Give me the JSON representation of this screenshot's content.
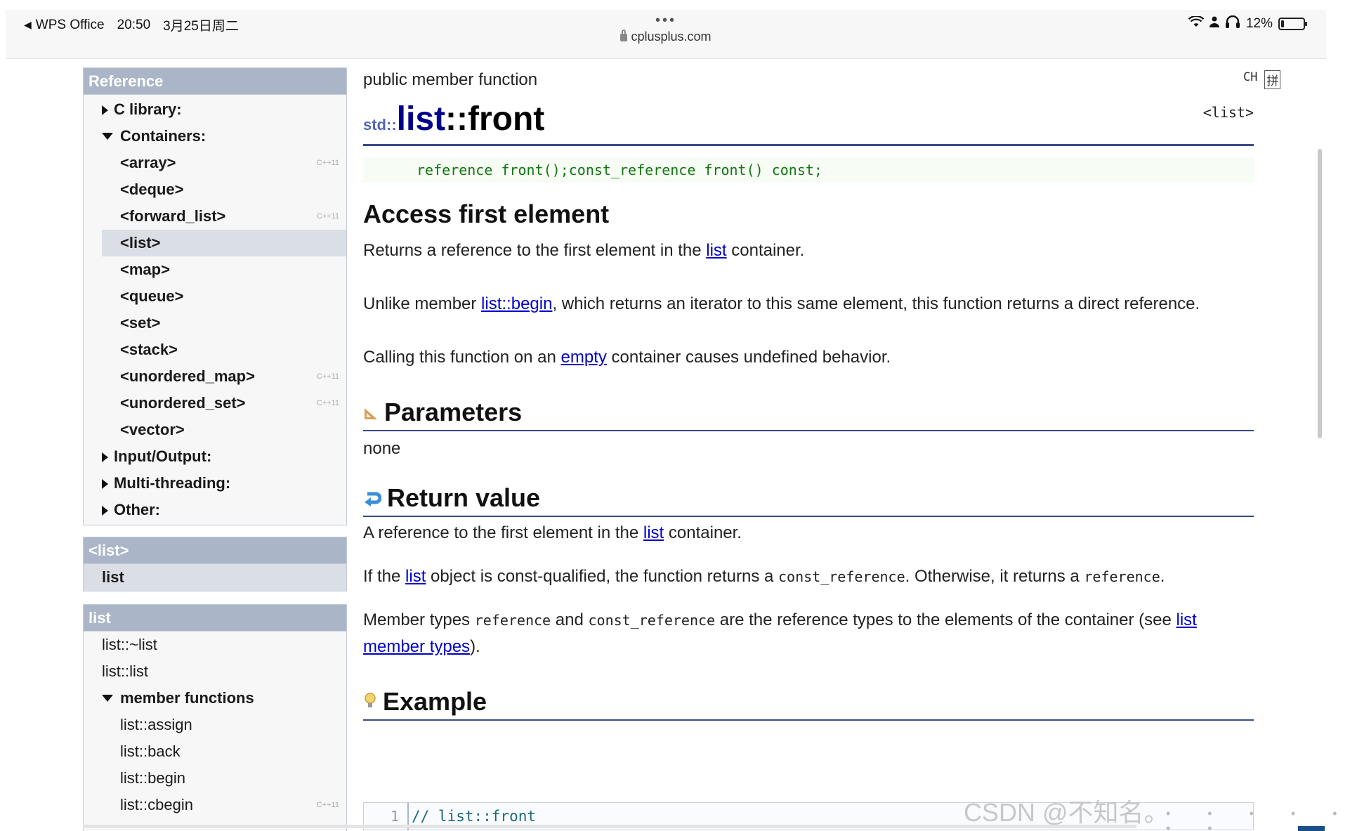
{
  "status_bar": {
    "back_app": "WPS Office",
    "time": "20:50",
    "date": "3月25日周二",
    "url": "cplusplus.com",
    "dots": "•••",
    "battery": "12%",
    "battery_level": 0.12
  },
  "sidebar": {
    "reference": {
      "heading": "Reference",
      "items": [
        {
          "label": "C library:",
          "level": 1,
          "toggle": "collapsed"
        },
        {
          "label": "Containers:",
          "level": 1,
          "toggle": "expanded"
        },
        {
          "label": "<array>",
          "level": 2,
          "badge": "C++11"
        },
        {
          "label": "<deque>",
          "level": 2
        },
        {
          "label": "<forward_list>",
          "level": 2,
          "badge": "C++11"
        },
        {
          "label": "<list>",
          "level": 2,
          "active": true
        },
        {
          "label": "<map>",
          "level": 2
        },
        {
          "label": "<queue>",
          "level": 2
        },
        {
          "label": "<set>",
          "level": 2
        },
        {
          "label": "<stack>",
          "level": 2
        },
        {
          "label": "<unordered_map>",
          "level": 2,
          "badge": "C++11"
        },
        {
          "label": "<unordered_set>",
          "level": 2,
          "badge": "C++11"
        },
        {
          "label": "<vector>",
          "level": 2
        },
        {
          "label": "Input/Output:",
          "level": 1,
          "toggle": "collapsed"
        },
        {
          "label": "Multi-threading:",
          "level": 1,
          "toggle": "collapsed"
        },
        {
          "label": "Other:",
          "level": 1,
          "toggle": "collapsed"
        }
      ]
    },
    "header_box": {
      "heading": "<list>",
      "item": "list"
    },
    "members_box": {
      "heading": "list",
      "items": [
        {
          "label": "list::~list",
          "level": 1
        },
        {
          "label": "list::list",
          "level": 1
        },
        {
          "label": "member functions",
          "level": 1,
          "toggle": "expanded",
          "bold": true
        },
        {
          "label": "list::assign",
          "level": 2
        },
        {
          "label": "list::back",
          "level": 2
        },
        {
          "label": "list::begin",
          "level": 2
        },
        {
          "label": "list::cbegin",
          "level": 2,
          "badge": "C++11"
        }
      ]
    }
  },
  "main": {
    "kind": "public member function",
    "std_prefix": "std::",
    "fn_class": "list",
    "fn_rest": "::front",
    "header": "<list>",
    "prototype": "reference front();const_reference front() const;",
    "title": "Access first element",
    "p1": {
      "a": "Returns a reference to the first element in the ",
      "link": "list",
      "b": " container."
    },
    "p2": {
      "a": "Unlike member ",
      "link": "list::begin",
      "b": ", which returns an iterator to this same element, this function returns a direct reference."
    },
    "p3": {
      "a": "Calling this function on an ",
      "link": "empty",
      "b": " container causes undefined behavior."
    },
    "parameters": {
      "title": "Parameters",
      "text": "none"
    },
    "return_value": {
      "title": "Return value",
      "r1": {
        "a": "A reference to the first element in the ",
        "link": "list",
        "b": " container."
      },
      "r2": {
        "a": "If the ",
        "link": "list",
        "b": " object is const-qualified, the function returns a ",
        "code1": "const_reference",
        "c": ". Otherwise, it returns a ",
        "code2": "reference",
        "d": "."
      },
      "r3": {
        "a": "Member types ",
        "code1": "reference",
        "b": " and ",
        "code2": "const_reference",
        "c": " are the reference types to the elements of the container (see ",
        "link": "list member types",
        "d": ")."
      }
    },
    "example": {
      "title": "Example",
      "line_no": "1",
      "code": "// list::front"
    }
  },
  "toolbar_right": {
    "ch": "CH",
    "pin": "拼"
  },
  "watermark": "CSDN @不知名。",
  "colors": {
    "sidebar_head": "#aab6c8",
    "title_blue": "#00008b",
    "link": "#0000cc",
    "rule": "#3a4a8c",
    "proto_green": "#117711"
  }
}
